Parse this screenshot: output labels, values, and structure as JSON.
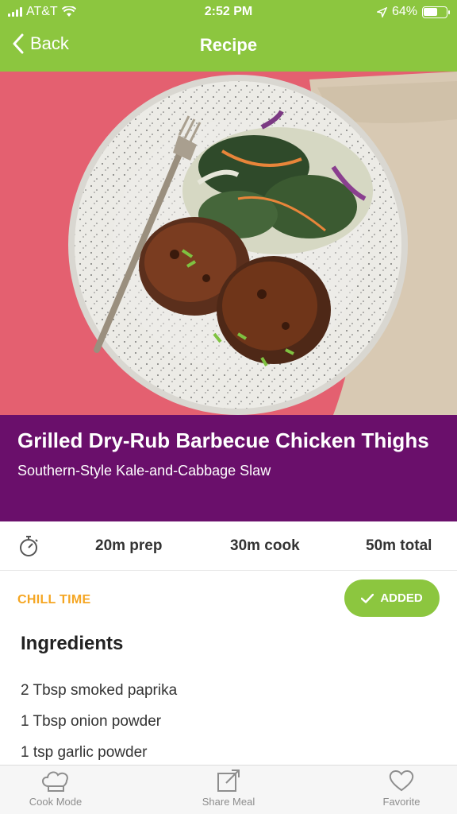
{
  "status_bar": {
    "carrier": "AT&T",
    "time": "2:52 PM",
    "battery": "64%",
    "battery_level": 0.64
  },
  "nav": {
    "back_label": "Back",
    "title": "Recipe"
  },
  "recipe": {
    "title": "Grilled Dry-Rub Barbecue Chicken Thighs",
    "subtitle": "Southern-Style Kale-and-Cabbage Slaw"
  },
  "times": {
    "prep": "20m prep",
    "cook": "30m cook",
    "total": "50m total"
  },
  "chill_label": "CHILL TIME",
  "added_label": "ADDED",
  "ingredients": {
    "title": "Ingredients",
    "items": [
      "2 Tbsp smoked paprika",
      "1 Tbsp onion powder",
      "1 tsp garlic powder"
    ]
  },
  "tabbar": {
    "cook_mode": "Cook Mode",
    "share_meal": "Share Meal",
    "favorite": "Favorite"
  },
  "colors": {
    "header": "#8cc63f",
    "title_band": "#6a0f6b",
    "chill": "#f5a623",
    "hero_bg": "#e25e6e"
  }
}
